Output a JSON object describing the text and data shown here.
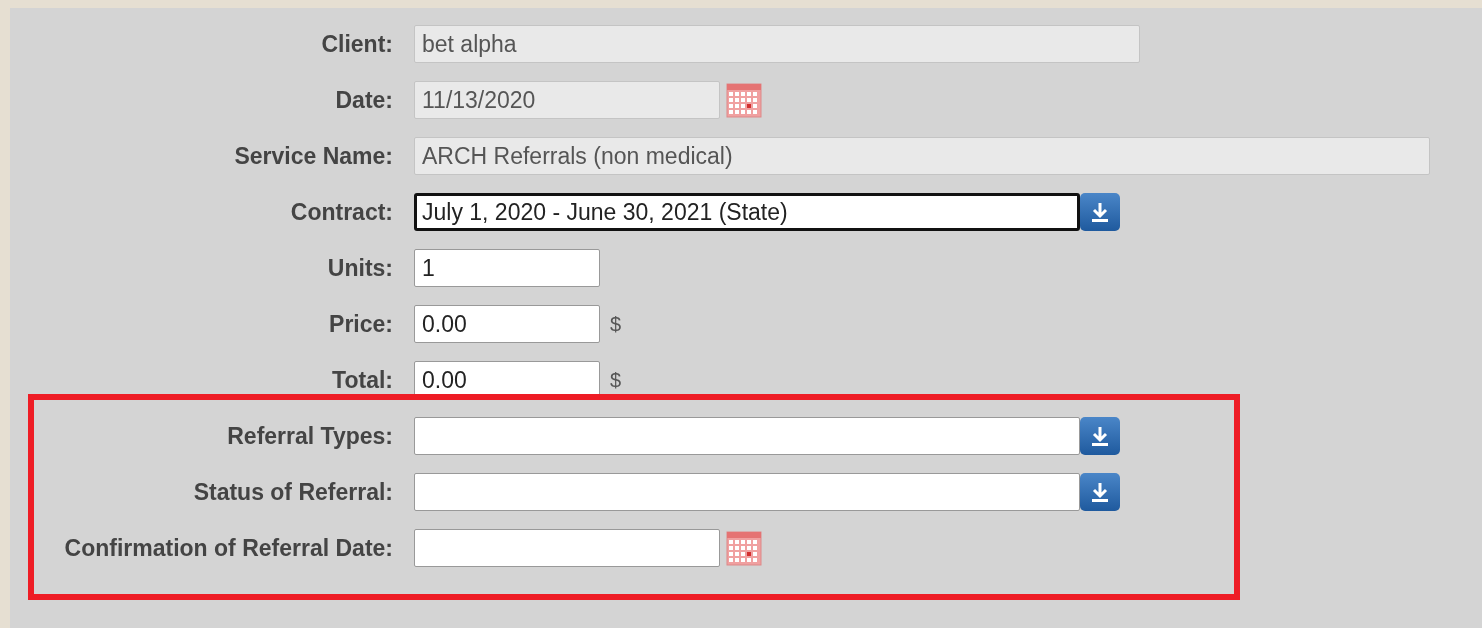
{
  "fields": [
    {
      "label": "Client:",
      "kind": "text",
      "value": "bet alpha",
      "disabled": true
    },
    {
      "label": "Date:",
      "kind": "date",
      "value": "11/13/2020",
      "disabled": true
    },
    {
      "label": "Service Name:",
      "kind": "text",
      "value": "ARCH Referrals (non medical)",
      "disabled": true
    },
    {
      "label": "Contract:",
      "kind": "select",
      "value": "July 1, 2020 - June 30, 2021 (State)",
      "disabled": false,
      "focused": true
    },
    {
      "label": "Units:",
      "kind": "text",
      "value": "1",
      "disabled": false
    },
    {
      "label": "Price:",
      "kind": "money",
      "value": "0.00",
      "disabled": false,
      "suffix": "$"
    },
    {
      "label": "Total:",
      "kind": "money",
      "value": "0.00",
      "disabled": false,
      "suffix": "$"
    },
    {
      "label": "Referral Types:",
      "kind": "select",
      "disabled": false,
      "focused": false
    },
    {
      "label": "Status of Referral:",
      "kind": "select",
      "disabled": false,
      "focused": false
    },
    {
      "label": "Confirmation of Referral Date:",
      "kind": "date",
      "disabled": false
    }
  ]
}
